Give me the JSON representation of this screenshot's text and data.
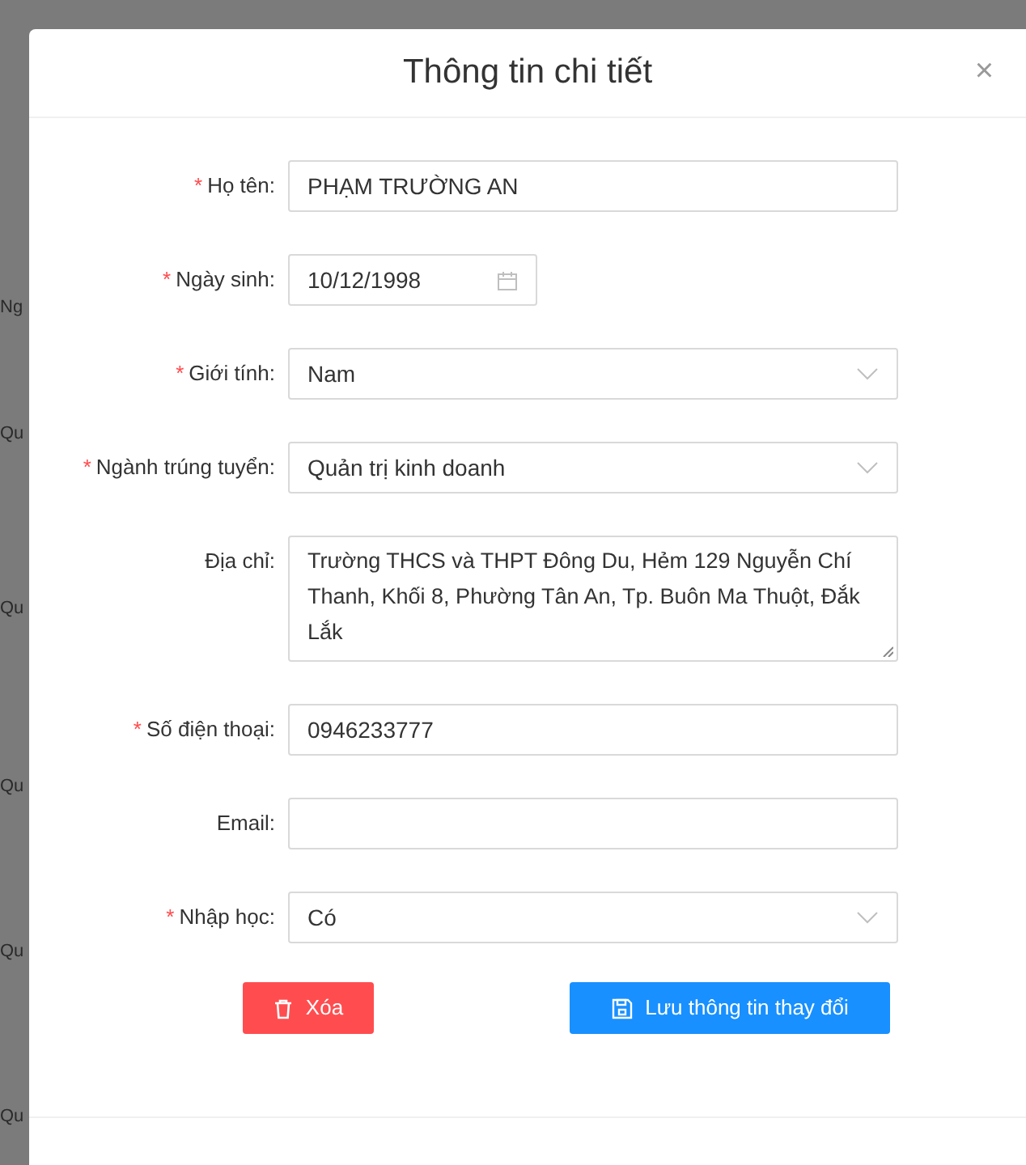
{
  "background": {
    "cells": [
      "Ng",
      "Qu",
      "Qu",
      "Qu",
      "Qu",
      "Qu"
    ]
  },
  "modal": {
    "title": "Thông tin chi tiết",
    "close": "×"
  },
  "form": [
    {
      "kind": "text",
      "required_mark": "*",
      "label": "Họ tên:",
      "value": "PHẠM TRƯỜNG AN"
    },
    {
      "kind": "date",
      "required_mark": "*",
      "label": "Ngày sinh:",
      "value": "10/12/1998"
    },
    {
      "kind": "select",
      "required_mark": "*",
      "label": "Giới tính:",
      "value": "Nam"
    },
    {
      "kind": "select",
      "required_mark": "*",
      "label": "Ngành trúng tuyển:",
      "value": "Quản trị kinh doanh"
    },
    {
      "kind": "textarea",
      "label": "Địa chỉ:",
      "value": "Trường THCS và THPT Đông Du, Hẻm 129 Nguyễn Chí Thanh, Khối 8, Phường Tân An, Tp. Buôn Ma Thuột, Đắk Lắk"
    },
    {
      "kind": "text",
      "required_mark": "*",
      "label": "Số điện thoại:",
      "value": "0946233777"
    },
    {
      "kind": "text",
      "label": "Email:"
    },
    {
      "kind": "select",
      "required_mark": "*",
      "label": "Nhập học:",
      "value": "Có"
    }
  ],
  "buttons": [
    {
      "kind": "danger",
      "label": "Xóa"
    },
    {
      "kind": "primary",
      "label": "Lưu thông tin thay đổi"
    }
  ]
}
